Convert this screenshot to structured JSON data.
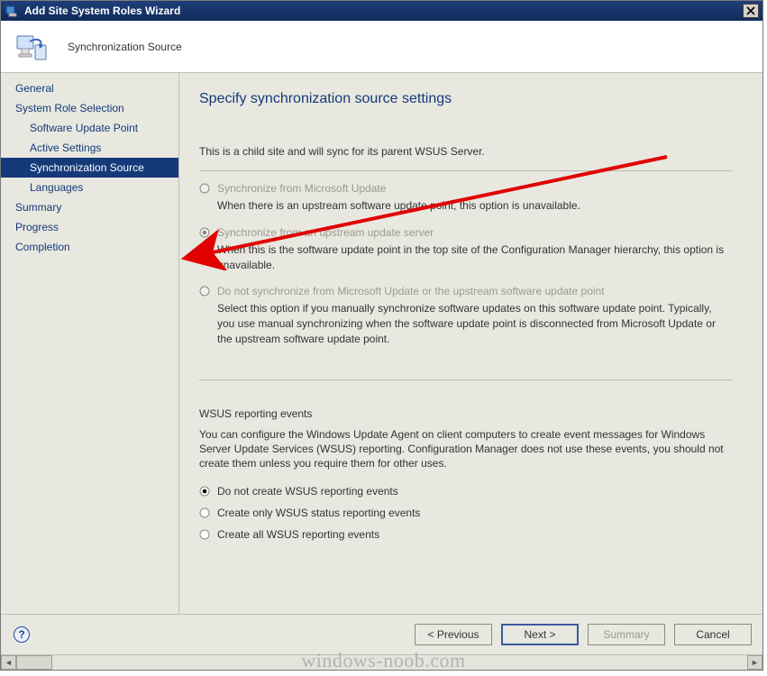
{
  "titlebar": {
    "title": "Add Site System Roles Wizard"
  },
  "header": {
    "subtitle": "Synchronization Source"
  },
  "nav": {
    "items": [
      {
        "label": "General",
        "indent": 0,
        "selected": false
      },
      {
        "label": "System Role Selection",
        "indent": 0,
        "selected": false
      },
      {
        "label": "Software Update Point",
        "indent": 1,
        "selected": false
      },
      {
        "label": "Active Settings",
        "indent": 1,
        "selected": false
      },
      {
        "label": "Synchronization Source",
        "indent": 1,
        "selected": true
      },
      {
        "label": "Languages",
        "indent": 1,
        "selected": false
      },
      {
        "label": "Summary",
        "indent": 0,
        "selected": false
      },
      {
        "label": "Progress",
        "indent": 0,
        "selected": false
      },
      {
        "label": "Completion",
        "indent": 0,
        "selected": false
      }
    ]
  },
  "main": {
    "heading": "Specify synchronization source settings",
    "intro": "This is a child site and will sync for its parent WSUS Server.",
    "options": [
      {
        "label": "Synchronize from Microsoft Update",
        "desc": "When there is an upstream software update point, this option is unavailable.",
        "disabled": true,
        "selected": false
      },
      {
        "label": "Synchronize from an upstream update server",
        "desc": "When this is the software update point in the top site of the Configuration Manager hierarchy, this option is unavailable.",
        "disabled": true,
        "selected": true
      },
      {
        "label": "Do not synchronize from Microsoft Update or the upstream software update point",
        "desc": "Select this option if you manually synchronize software updates on this software update point. Typically, you use manual synchronizing when the software update point is disconnected from Microsoft Update or the upstream software update point.",
        "disabled": true,
        "selected": false
      }
    ],
    "reporting": {
      "title": "WSUS reporting events",
      "desc": "You can configure the Windows Update Agent on client computers to create event messages for Windows Server Update Services (WSUS) reporting. Configuration Manager does not use these events, you should not create them unless you require them for other uses.",
      "radios": [
        {
          "label": "Do not create WSUS reporting events",
          "selected": true
        },
        {
          "label": "Create only WSUS status reporting events",
          "selected": false
        },
        {
          "label": "Create all WSUS reporting events",
          "selected": false
        }
      ]
    }
  },
  "footer": {
    "previous": "< Previous",
    "next": "Next >",
    "summary": "Summary",
    "cancel": "Cancel"
  },
  "watermark": "windows-noob.com"
}
